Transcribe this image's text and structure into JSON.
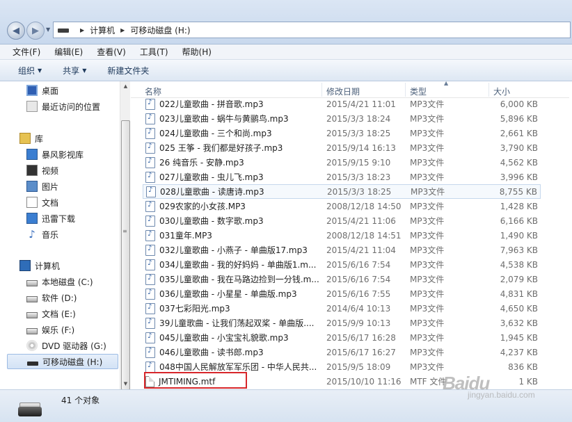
{
  "address": {
    "breadcrumb": [
      "计算机",
      "可移动磁盘 (H:)"
    ]
  },
  "menu": [
    "文件(F)",
    "编辑(E)",
    "查看(V)",
    "工具(T)",
    "帮助(H)"
  ],
  "toolbar": {
    "organize": "组织",
    "share": "共享",
    "new_folder": "新建文件夹"
  },
  "nav": {
    "favorites": [
      {
        "label": "桌面",
        "icon": "desktop-icon"
      },
      {
        "label": "最近访问的位置",
        "icon": "recent-places-icon"
      }
    ],
    "libraries_label": "库",
    "libraries": [
      {
        "label": "暴风影视库",
        "icon": "video-library-icon"
      },
      {
        "label": "视频",
        "icon": "video-icon"
      },
      {
        "label": "图片",
        "icon": "picture-icon"
      },
      {
        "label": "文档",
        "icon": "document-icon"
      },
      {
        "label": "迅雷下载",
        "icon": "xunlei-download-icon"
      },
      {
        "label": "音乐",
        "icon": "music-icon"
      }
    ],
    "computer_label": "计算机",
    "drives": [
      {
        "label": "本地磁盘 (C:)",
        "icon": "system-drive-icon"
      },
      {
        "label": "软件 (D:)",
        "icon": "drive-icon"
      },
      {
        "label": "文档 (E:)",
        "icon": "drive-icon"
      },
      {
        "label": "娱乐 (F:)",
        "icon": "drive-icon"
      },
      {
        "label": "DVD 驱动器 (G:)",
        "icon": "dvd-drive-icon"
      },
      {
        "label": "可移动磁盘 (H:)",
        "icon": "removable-drive-icon",
        "selected": true
      }
    ]
  },
  "columns": {
    "name": "名称",
    "date": "修改日期",
    "type": "类型",
    "size": "大小"
  },
  "files": [
    {
      "name": "022儿童歌曲 - 拼音歌.mp3",
      "date": "2015/4/21 11:01",
      "type": "MP3文件",
      "size": "6,000 KB"
    },
    {
      "name": "023儿童歌曲 - 蜗牛与黄鹂鸟.mp3",
      "date": "2015/3/3 18:24",
      "type": "MP3文件",
      "size": "5,896 KB"
    },
    {
      "name": "024儿童歌曲 - 三个和尚.mp3",
      "date": "2015/3/3 18:25",
      "type": "MP3文件",
      "size": "2,661 KB"
    },
    {
      "name": "025 王筝 - 我们都是好孩子.mp3",
      "date": "2015/9/14 16:13",
      "type": "MP3文件",
      "size": "3,790 KB"
    },
    {
      "name": "26 纯音乐 - 安静.mp3",
      "date": "2015/9/15 9:10",
      "type": "MP3文件",
      "size": "4,562 KB"
    },
    {
      "name": "027儿童歌曲 - 虫儿飞.mp3",
      "date": "2015/3/3 18:23",
      "type": "MP3文件",
      "size": "3,996 KB"
    },
    {
      "name": "028儿童歌曲 - 读唐诗.mp3",
      "date": "2015/3/3 18:25",
      "type": "MP3文件",
      "size": "8,755 KB",
      "selected": true
    },
    {
      "name": "029农家的小女孩.MP3",
      "date": "2008/12/18 14:50",
      "type": "MP3文件",
      "size": "1,428 KB"
    },
    {
      "name": "030儿童歌曲 - 数字歌.mp3",
      "date": "2015/4/21 11:06",
      "type": "MP3文件",
      "size": "6,166 KB"
    },
    {
      "name": "031童年.MP3",
      "date": "2008/12/18 14:51",
      "type": "MP3文件",
      "size": "1,490 KB"
    },
    {
      "name": "032儿童歌曲 - 小燕子 - 单曲版17.mp3",
      "date": "2015/4/21 11:04",
      "type": "MP3文件",
      "size": "7,963 KB"
    },
    {
      "name": "034儿童歌曲 - 我的好妈妈 - 单曲版1.m...",
      "date": "2015/6/16 7:54",
      "type": "MP3文件",
      "size": "4,538 KB"
    },
    {
      "name": "035儿童歌曲 - 我在马路边捡到一分钱.m...",
      "date": "2015/6/16 7:54",
      "type": "MP3文件",
      "size": "2,079 KB"
    },
    {
      "name": "036儿童歌曲 - 小星星 - 单曲版.mp3",
      "date": "2015/6/16 7:55",
      "type": "MP3文件",
      "size": "4,831 KB"
    },
    {
      "name": "037七彩阳光.mp3",
      "date": "2014/6/4 10:13",
      "type": "MP3文件",
      "size": "4,650 KB"
    },
    {
      "name": "39儿童歌曲 - 让我们荡起双桨 - 单曲版....",
      "date": "2015/9/9 10:13",
      "type": "MP3文件",
      "size": "3,632 KB"
    },
    {
      "name": "045儿童歌曲 - 小宝宝礼貌歌.mp3",
      "date": "2015/6/17 16:28",
      "type": "MP3文件",
      "size": "1,945 KB"
    },
    {
      "name": "046儿童歌曲 - 读书郎.mp3",
      "date": "2015/6/17 16:27",
      "type": "MP3文件",
      "size": "4,237 KB"
    },
    {
      "name": "048中国人民解放军军乐团 - 中华人民共...",
      "date": "2015/9/5 18:09",
      "type": "MP3文件",
      "size": "836 KB"
    },
    {
      "name": "JMTIMING.mtf",
      "date": "2015/10/10 11:16",
      "type": "MTF 文件",
      "size": "1 KB",
      "highlighted": true
    }
  ],
  "status": {
    "count": "41 个对象"
  },
  "watermark": {
    "logo": "Baidu",
    "sub": "jingyan.baidu.com"
  }
}
